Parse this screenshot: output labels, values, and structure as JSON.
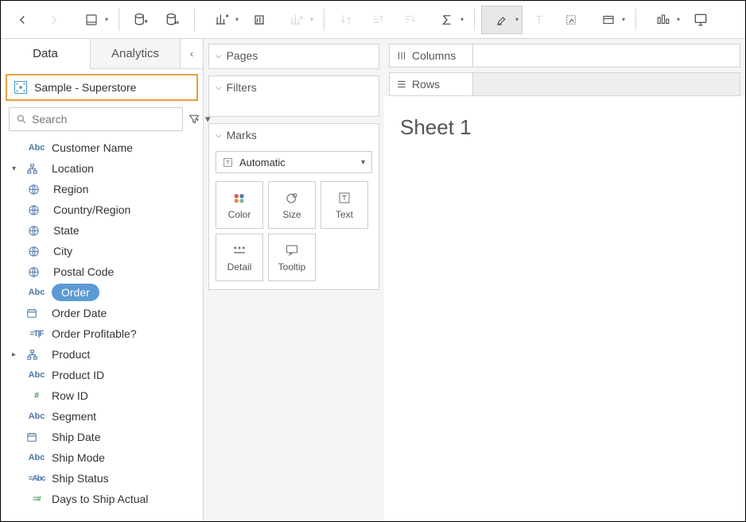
{
  "tabs": {
    "data": "Data",
    "analytics": "Analytics"
  },
  "datasource": "Sample - Superstore",
  "search_placeholder": "Search",
  "fields": [
    {
      "icon": "abc",
      "iconCls": "dim",
      "label": "Customer Name",
      "indent": 0,
      "caret": ""
    },
    {
      "icon": "hier",
      "iconCls": "hier",
      "label": "Location",
      "indent": 0,
      "caret": "down"
    },
    {
      "icon": "globe",
      "iconCls": "globe",
      "label": "Region",
      "indent": 1,
      "caret": ""
    },
    {
      "icon": "globe",
      "iconCls": "globe",
      "label": "Country/Region",
      "indent": 1,
      "caret": ""
    },
    {
      "icon": "globe",
      "iconCls": "globe",
      "label": "State",
      "indent": 1,
      "caret": ""
    },
    {
      "icon": "globe",
      "iconCls": "globe",
      "label": "City",
      "indent": 1,
      "caret": ""
    },
    {
      "icon": "globe",
      "iconCls": "globe",
      "label": "Postal Code",
      "indent": 1,
      "caret": ""
    },
    {
      "icon": "abc",
      "iconCls": "dim",
      "label": "Order",
      "indent": 0,
      "caret": "",
      "pill": true
    },
    {
      "icon": "cal",
      "iconCls": "cal",
      "label": "Order Date",
      "indent": 0,
      "caret": ""
    },
    {
      "icon": "tf",
      "iconCls": "tf",
      "label": "Order Profitable?",
      "indent": 0,
      "caret": ""
    },
    {
      "icon": "hier",
      "iconCls": "hier",
      "label": "Product",
      "indent": 0,
      "caret": "right"
    },
    {
      "icon": "abc",
      "iconCls": "dim",
      "label": "Product ID",
      "indent": 0,
      "caret": ""
    },
    {
      "icon": "hash",
      "iconCls": "hash",
      "label": "Row ID",
      "indent": 0,
      "caret": ""
    },
    {
      "icon": "abc",
      "iconCls": "dim",
      "label": "Segment",
      "indent": 0,
      "caret": ""
    },
    {
      "icon": "cal",
      "iconCls": "cal",
      "label": "Ship Date",
      "indent": 0,
      "caret": ""
    },
    {
      "icon": "abc",
      "iconCls": "dim",
      "label": "Ship Mode",
      "indent": 0,
      "caret": ""
    },
    {
      "icon": "eqabc",
      "iconCls": "eqabc",
      "label": "Ship Status",
      "indent": 0,
      "caret": ""
    },
    {
      "icon": "eqhash",
      "iconCls": "eqhash",
      "label": "Days to Ship Actual",
      "indent": 0,
      "caret": ""
    }
  ],
  "shelves": {
    "pages": "Pages",
    "filters": "Filters",
    "marks": "Marks"
  },
  "marks_dropdown": "Automatic",
  "mark_cards": {
    "color": "Color",
    "size": "Size",
    "text": "Text",
    "detail": "Detail",
    "tooltip": "Tooltip"
  },
  "right": {
    "columns": "Columns",
    "rows": "Rows"
  },
  "sheet_title": "Sheet 1"
}
